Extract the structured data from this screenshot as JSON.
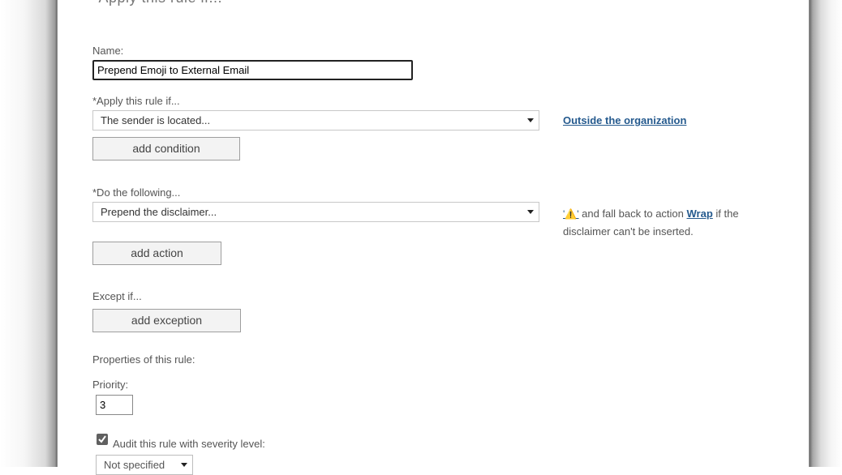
{
  "header": {
    "title": "*Apply this rule if..."
  },
  "name_field": {
    "label": "Name:",
    "value": "Prepend Emoji to External Email"
  },
  "condition": {
    "label": "*Apply this rule if...",
    "selected": "The sender is located...",
    "value_link": "Outside the organization",
    "add_button": "add condition"
  },
  "action": {
    "label": "*Do the following...",
    "selected": "Prepend the disclaimer...",
    "disclaimer_link": "'⚠️'",
    "text_part1": " and fall back to action ",
    "fallback_link": "Wrap",
    "text_part2": " if the disclaimer can't be inserted.",
    "add_button": "add action"
  },
  "exception": {
    "label": "Except if...",
    "add_button": "add exception"
  },
  "properties": {
    "label": "Properties of this rule:",
    "priority_label": "Priority:",
    "priority_value": "3",
    "audit_label": "Audit this rule with severity level:",
    "audit_checked": true,
    "severity_selected": "Not specified"
  },
  "icons": {
    "checkmark": "checkmark-icon",
    "dropdown": "chevron-down-icon",
    "warning": "warning-icon"
  },
  "colors": {
    "link": "#255a8e",
    "button_bg": "#f3f3f3",
    "checkbox_bg": "#606060"
  }
}
